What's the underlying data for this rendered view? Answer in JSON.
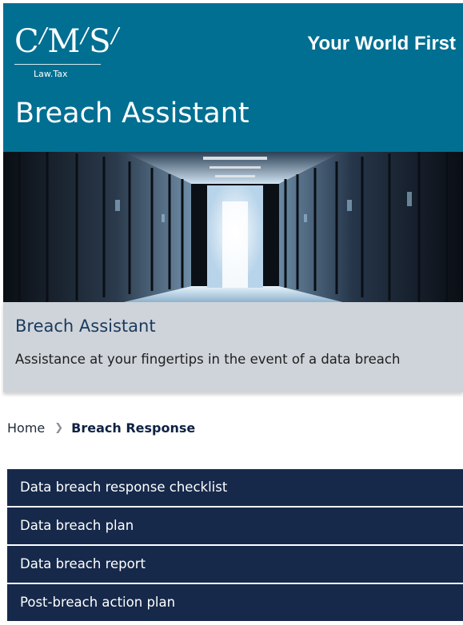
{
  "header": {
    "logo_letter_c": "C",
    "logo_letter_m": "M",
    "logo_letter_s": "S",
    "logo_slash": "/",
    "logo_sub": "Law.Tax",
    "slogan": "Your World First",
    "app_title": "Breach Assistant",
    "background_color": "#016f92"
  },
  "hero": {
    "image": "server-room-corridor-image"
  },
  "intro": {
    "title": "Breach Assistant",
    "subtitle": "Assistance at your fingertips in the event of a data breach"
  },
  "breadcrumb": {
    "home": "Home",
    "separator_icon": "chevron-right-icon",
    "current": "Breach Response"
  },
  "menu": {
    "background_color": "#16294a",
    "items": [
      {
        "label": "Data breach response checklist"
      },
      {
        "label": "Data breach plan"
      },
      {
        "label": "Data breach report"
      },
      {
        "label": "Post-breach action plan"
      }
    ]
  }
}
